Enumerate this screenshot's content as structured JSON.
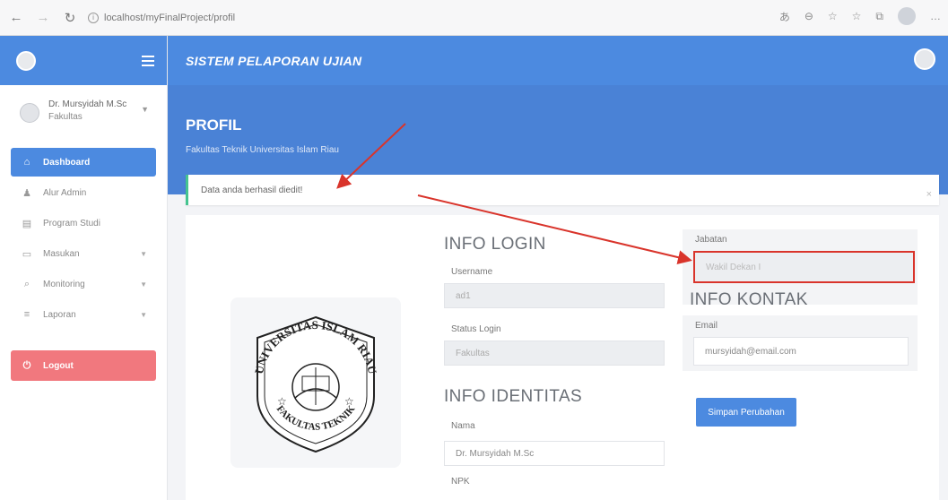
{
  "browser": {
    "url": "localhost/myFinalProject/profil",
    "back": "←",
    "forward": "→",
    "reload": "↻",
    "info": "i"
  },
  "sidebar": {
    "user": {
      "name": "Dr. Mursyidah M.Sc",
      "role": "Fakultas"
    },
    "items": [
      {
        "label": "Dashboard",
        "icon": "home-icon",
        "glyph": "⌂"
      },
      {
        "label": "Alur Admin",
        "icon": "user-icon",
        "glyph": "♟"
      },
      {
        "label": "Program Studi",
        "icon": "book-icon",
        "glyph": "▤"
      },
      {
        "label": "Masukan",
        "icon": "inbox-icon",
        "glyph": "▭"
      },
      {
        "label": "Monitoring",
        "icon": "search-icon",
        "glyph": "⌕"
      },
      {
        "label": "Laporan",
        "icon": "list-icon",
        "glyph": "≡"
      },
      {
        "label": "Logout",
        "icon": "power-icon",
        "glyph": "⏻"
      }
    ]
  },
  "header": {
    "title": "SISTEM PELAPORAN UJIAN",
    "page_title": "PROFIL",
    "page_subtitle": "Fakultas Teknik Universitas Islam Riau"
  },
  "alert": {
    "message": "Data anda berhasil diedit!",
    "close": "×"
  },
  "emblem": {
    "text_top": "UNIVERSITAS ISLAM RIAU",
    "text_bottom": "FAKULTAS TEKNIK"
  },
  "info_login": {
    "title": "INFO LOGIN",
    "username_label": "Username",
    "username_value": "ad1",
    "status_label": "Status Login",
    "status_value": "Fakultas"
  },
  "info_identitas": {
    "title": "INFO IDENTITAS",
    "nama_label": "Nama",
    "nama_value": "Dr. Mursyidah M.Sc",
    "npk_label": "NPK"
  },
  "jabatan": {
    "label": "Jabatan",
    "value": "Wakil Dekan I"
  },
  "info_kontak": {
    "title": "INFO KONTAK",
    "email_label": "Email",
    "email_value": "mursyidah@email.com"
  },
  "buttons": {
    "save": "Simpan Perubahan"
  },
  "colors": {
    "primary": "#4c8ae0",
    "logout": "#f1787e",
    "success": "#45c490",
    "annotation": "#d9342b"
  }
}
